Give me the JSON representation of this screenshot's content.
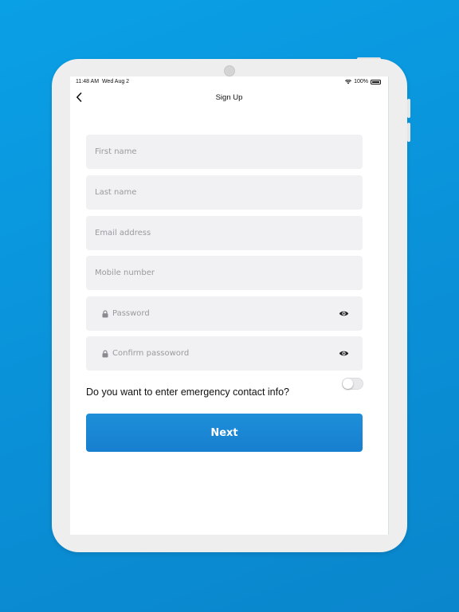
{
  "status_bar": {
    "time": "11:48 AM",
    "date": "Wed Aug 2",
    "battery": "100%"
  },
  "nav": {
    "title": "Sign Up",
    "back_icon": "chevron-left-icon"
  },
  "form": {
    "first_name": {
      "placeholder": "First name",
      "value": ""
    },
    "last_name": {
      "placeholder": "Last name",
      "value": ""
    },
    "email": {
      "placeholder": "Email address",
      "value": ""
    },
    "mobile": {
      "placeholder": "Mobile number",
      "value": ""
    },
    "password": {
      "placeholder": "Password",
      "value": "",
      "icon": "lock-icon",
      "toggle_icon": "eye-icon"
    },
    "confirm_password": {
      "placeholder": "Confirm passoword",
      "value": "",
      "icon": "lock-icon",
      "toggle_icon": "eye-icon"
    }
  },
  "emergency": {
    "question": "Do you want to enter emergency contact info?",
    "toggle_on": false
  },
  "next_button": {
    "label": "Next"
  },
  "colors": {
    "background": "#0a96dc",
    "primary_button": "#1a86d3",
    "field_background": "#f1f1f3",
    "tablet_bezel": "#eeeeee"
  }
}
